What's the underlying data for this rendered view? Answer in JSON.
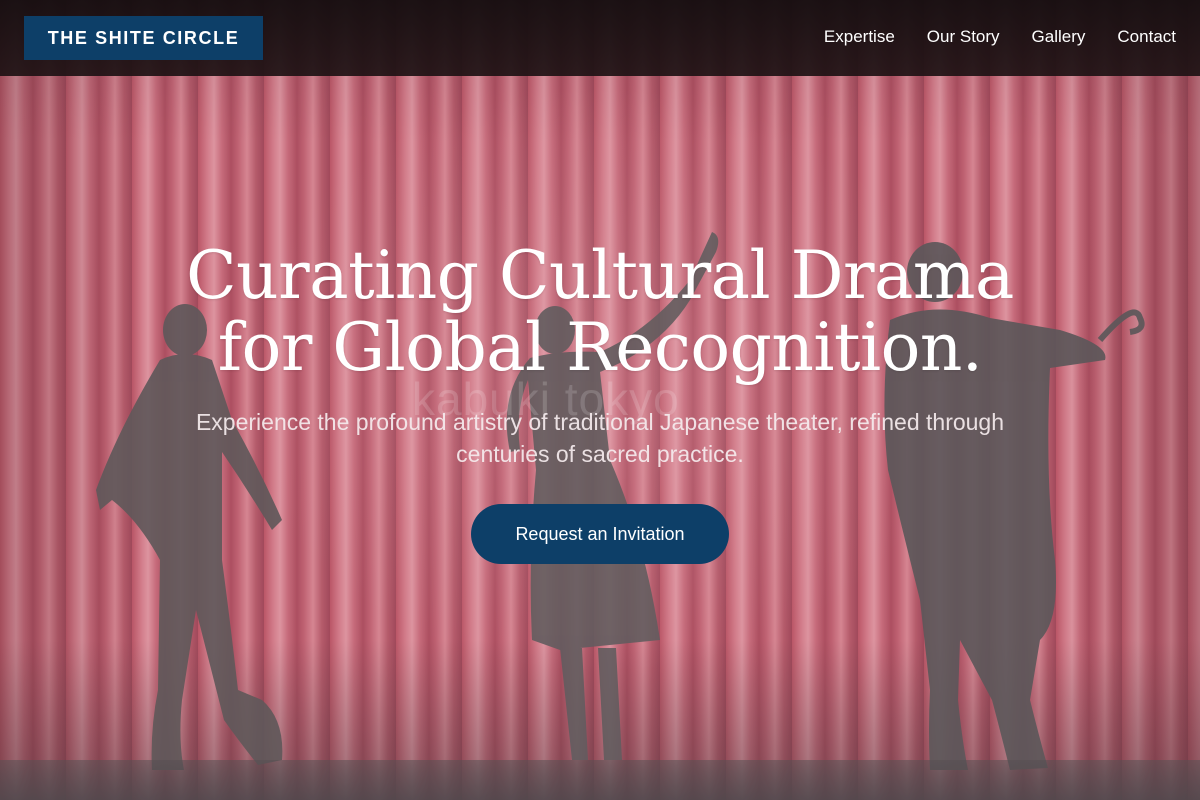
{
  "header": {
    "logo_text": "THE SHITE CIRCLE",
    "nav": [
      {
        "label": "Expertise"
      },
      {
        "label": "Our Story"
      },
      {
        "label": "Gallery"
      },
      {
        "label": "Contact"
      }
    ]
  },
  "hero": {
    "title_line1": "Curating Cultural Drama",
    "title_line2": "for Global Recognition.",
    "subtitle": "Experience the profound artistry of traditional Japanese theater, refined through centuries of sacred practice.",
    "cta_label": "Request an Invitation",
    "photo_watermark": "kabuki tokyo"
  },
  "colors": {
    "brand_navy": "#0d3f68",
    "header_bg": "#1e1214",
    "curtain_red": "#e57b8b"
  }
}
